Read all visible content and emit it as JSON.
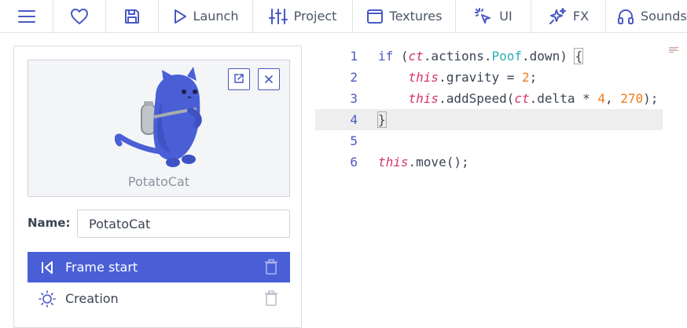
{
  "toolbar": {
    "menu_icon": "hamburger-icon",
    "favorite_icon": "heart-icon",
    "save_icon": "floppy-disk-icon",
    "launch_label": "Launch",
    "project_label": "Project",
    "textures_label": "Textures",
    "ui_label": "UI",
    "fx_label": "FX",
    "sounds_label": "Sounds"
  },
  "template": {
    "preview_name": "PotatoCat",
    "name_label": "Name:",
    "name_value": "PotatoCat",
    "events": [
      {
        "label": "Frame start",
        "icon": "frame-start-icon",
        "active": true
      },
      {
        "label": "Creation",
        "icon": "sun-icon",
        "active": false
      }
    ]
  },
  "editor": {
    "line_numbers": [
      "1",
      "2",
      "3",
      "4",
      "5",
      "6"
    ],
    "current_line": 4
  },
  "colors": {
    "accent": "#4a59c3",
    "active_row": "#4a5fd6",
    "keyword_pink": "#d6336c",
    "property_teal": "#2bb0b5",
    "number_orange": "#f07a1a"
  }
}
